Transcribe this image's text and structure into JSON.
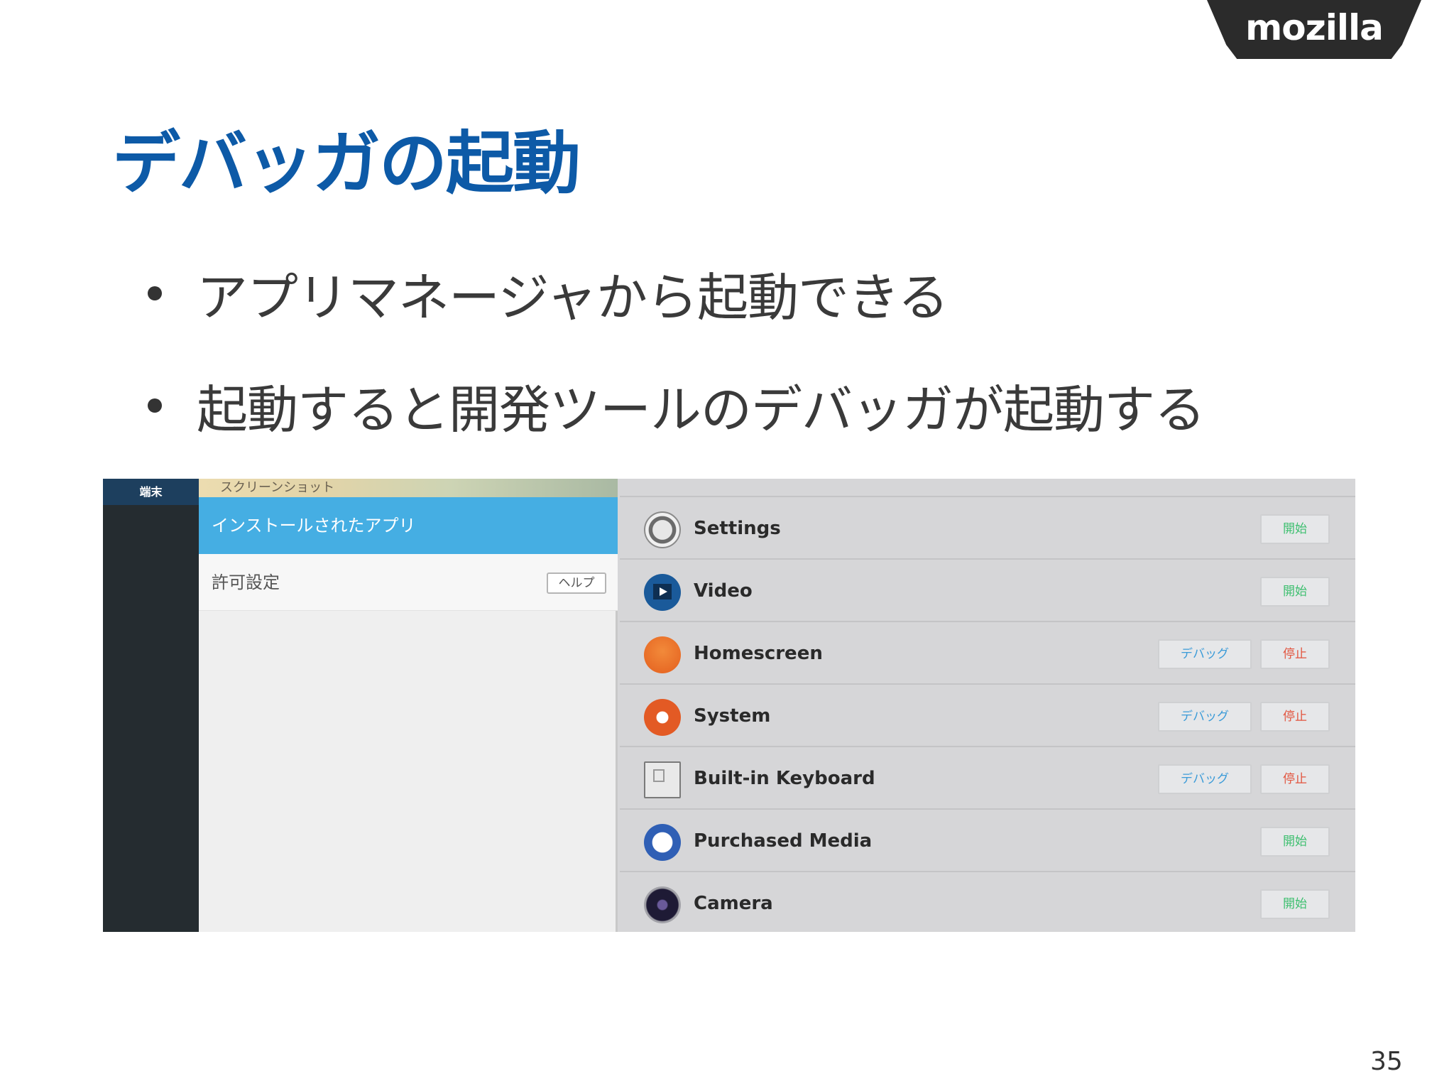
{
  "brand": {
    "logo_text": "mozilla"
  },
  "slide": {
    "title": "デバッガの起動",
    "bullets": [
      "アプリマネージャから起動できる",
      "起動すると開発ツールのデバッガが起動する"
    ],
    "page_number": "35"
  },
  "screenshot": {
    "rail_header": "端末",
    "top_strip_label": "スクリーンショット",
    "selected_item": "インストールされたアプリ",
    "permissions_item": "許可設定",
    "help_button": "ヘルプ",
    "apps": [
      {
        "name": "Settings",
        "icon": "settings-icon",
        "buttons": [
          "開始"
        ]
      },
      {
        "name": "Video",
        "icon": "video-icon",
        "buttons": [
          "開始"
        ]
      },
      {
        "name": "Homescreen",
        "icon": "homescreen-icon",
        "buttons": [
          "デバッグ",
          "停止"
        ]
      },
      {
        "name": "System",
        "icon": "system-icon",
        "buttons": [
          "デバッグ",
          "停止"
        ]
      },
      {
        "name": "Built-in Keyboard",
        "icon": "keyboard-icon",
        "buttons": [
          "デバッグ",
          "停止"
        ]
      },
      {
        "name": "Purchased Media",
        "icon": "purchased-media-icon",
        "buttons": [
          "開始"
        ]
      },
      {
        "name": "Camera",
        "icon": "camera-icon",
        "buttons": [
          "開始"
        ]
      }
    ]
  },
  "colors": {
    "title": "#0d5aa7",
    "selected_row": "#45aee3",
    "start": "#3dbf6f",
    "stop": "#e2533d",
    "debug": "#3b9bd8"
  }
}
